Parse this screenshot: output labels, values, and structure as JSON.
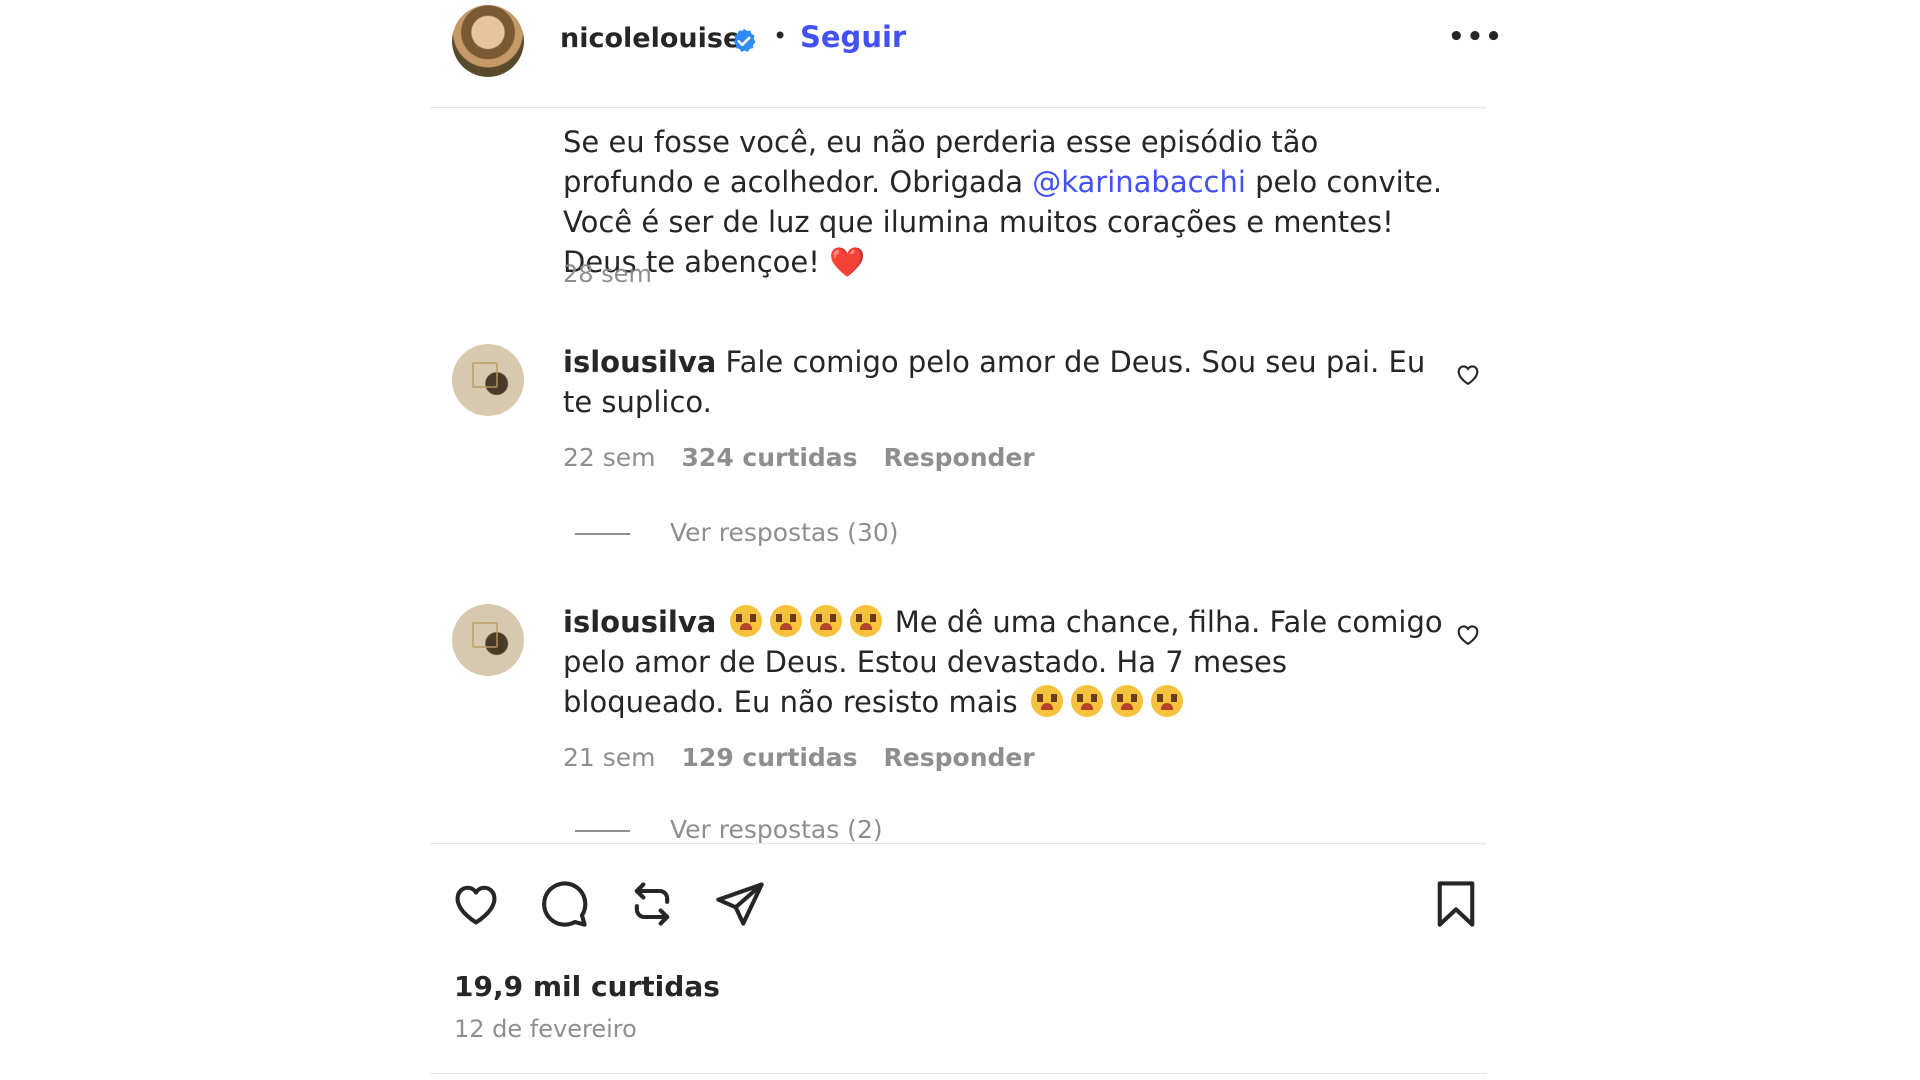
{
  "header": {
    "username": "nicolelouise",
    "follow_label": "Seguir",
    "dot": "•",
    "more_label": "•••"
  },
  "caption": {
    "part1": "Se eu fosse você, eu não perderia esse episódio tão profundo e acolhedor. Obrigada ",
    "mention": "@karinabacchi",
    "part2": " pelo convite. Você é ser de luz que ilumina muitos corações e mentes! Deus te abençoe! ",
    "heart": "❤️",
    "time": "28 sem"
  },
  "comments": [
    {
      "username": "islousilva",
      "text": "Fale comigo pelo amor de Deus. Sou seu pai. Eu te suplico.",
      "time": "22 sem",
      "likes": "324 curtidas",
      "reply_label": "Responder",
      "view_replies": "Ver respostas (30)"
    },
    {
      "username": "islousilva",
      "text": "Me dê uma chance, filha. Fale comigo pelo amor de Deus. Estou devastado. Ha 7 meses bloqueado. Eu não resisto mais",
      "emoji_name": "pleading-face-emoji",
      "time": "21 sem",
      "likes": "129 curtidas",
      "reply_label": "Responder",
      "view_replies": "Ver respostas (2)"
    }
  ],
  "footer": {
    "likes": "19,9 mil curtidas",
    "date": "12 de fevereiro"
  },
  "colors": {
    "link": "#4150f7",
    "muted": "#8e8e8e",
    "text": "#262626",
    "heart": "#f0365d"
  }
}
